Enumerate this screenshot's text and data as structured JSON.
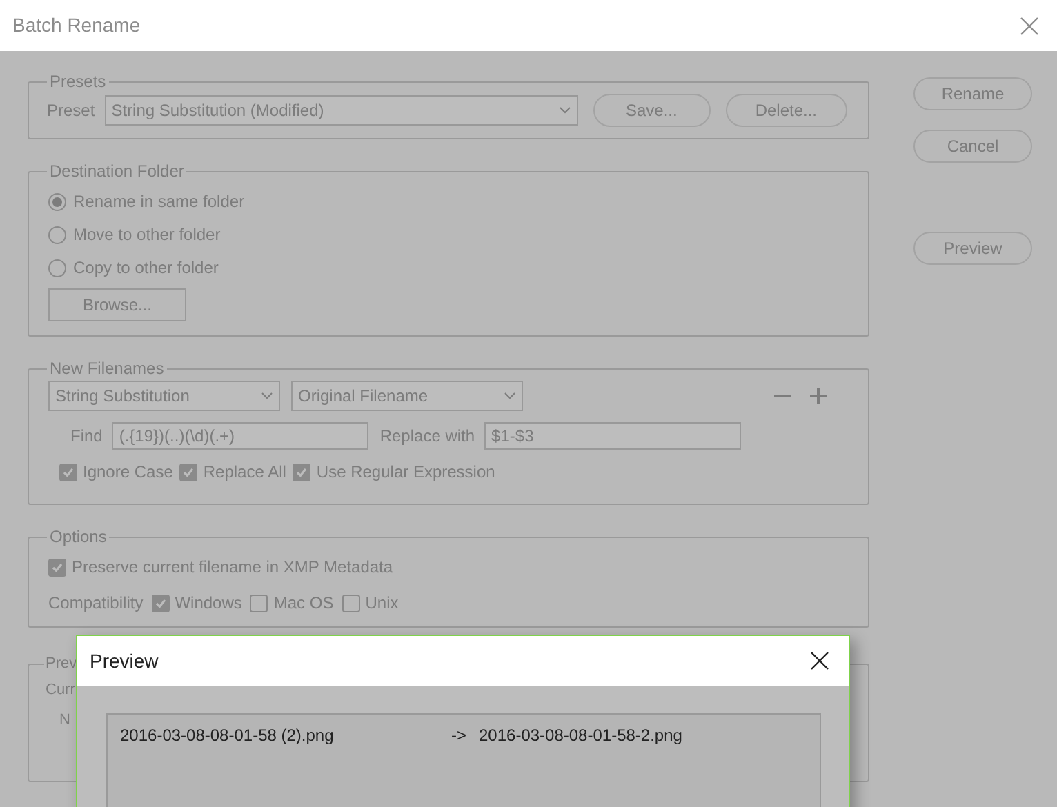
{
  "window": {
    "title": "Batch Rename"
  },
  "presets": {
    "legend": "Presets",
    "label": "Preset",
    "value": "String Substitution (Modified)",
    "buttons": [
      "Save...",
      "Delete..."
    ]
  },
  "destination": {
    "legend": "Destination Folder",
    "options": [
      {
        "label": "Rename in same folder",
        "selected": true
      },
      {
        "label": "Move to other folder",
        "selected": false
      },
      {
        "label": "Copy to other folder",
        "selected": false
      }
    ],
    "button": "Browse..."
  },
  "new_filenames": {
    "legend": "New Filenames",
    "type_select": "String Substitution",
    "source_select": "Original Filename",
    "find_label": "Find",
    "find_value": "(.{19})(..)(\\d)(.+)",
    "replace_label": "Replace with",
    "replace_value": "$1-$3",
    "checks": [
      {
        "label": "Ignore Case",
        "checked": true
      },
      {
        "label": "Replace All",
        "checked": true
      },
      {
        "label": "Use Regular Expression",
        "checked": true
      }
    ]
  },
  "options": {
    "legend": "Options",
    "preserve": {
      "label": "Preserve current filename in XMP Metadata",
      "checked": true
    },
    "compat_label": "Compatibility",
    "compat": [
      {
        "label": "Windows",
        "checked": true
      },
      {
        "label": "Mac OS",
        "checked": false
      },
      {
        "label": "Unix",
        "checked": false
      }
    ]
  },
  "preview_group": {
    "legend": "Prev",
    "lines": [
      "Curr",
      "N"
    ]
  },
  "side_buttons": [
    "Rename",
    "Cancel",
    "Preview"
  ],
  "preview_dialog": {
    "title": "Preview",
    "rows": [
      {
        "from": "2016-03-08-08-01-58 (2).png",
        "arrow": "->",
        "to": "2016-03-08-08-01-58-2.png"
      }
    ]
  }
}
